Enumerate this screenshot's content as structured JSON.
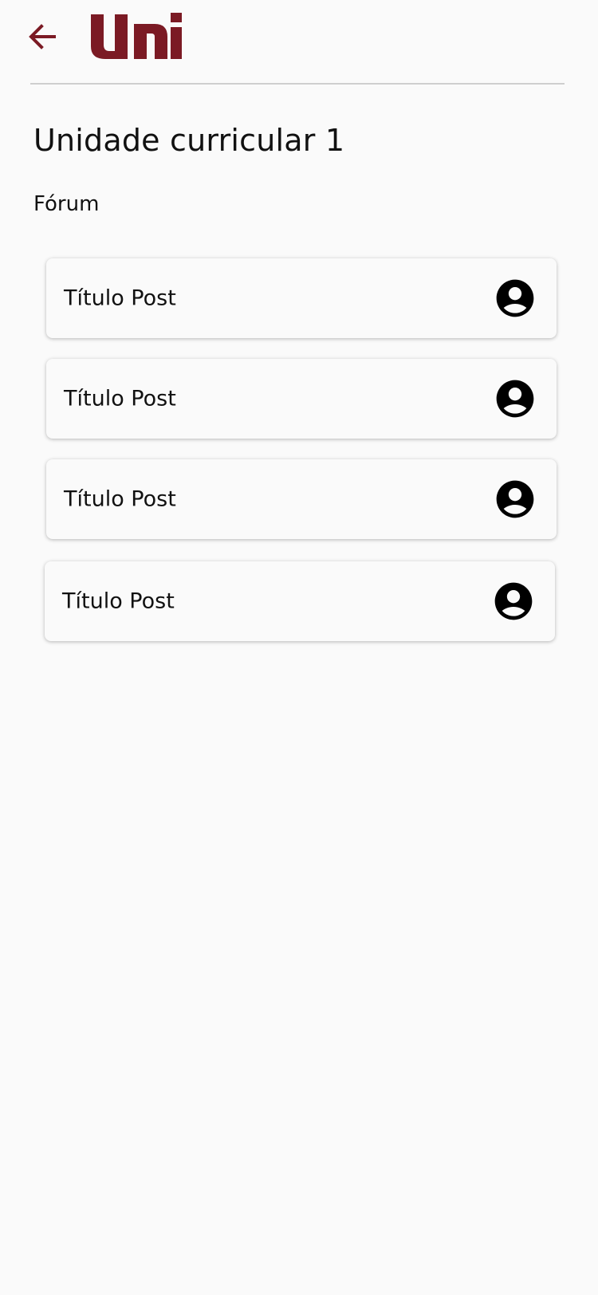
{
  "header": {
    "back_icon": "arrow-left-icon",
    "logo_text": "uni",
    "brand_color": "#7b1a24"
  },
  "page": {
    "title": "Unidade curricular 1",
    "section": "Fórum"
  },
  "posts": [
    {
      "title": "Título Post",
      "icon": "account-circle-icon"
    },
    {
      "title": "Título Post",
      "icon": "account-circle-icon"
    },
    {
      "title": "Título Post",
      "icon": "account-circle-icon"
    },
    {
      "title": "Título Post",
      "icon": "account-circle-icon"
    }
  ]
}
